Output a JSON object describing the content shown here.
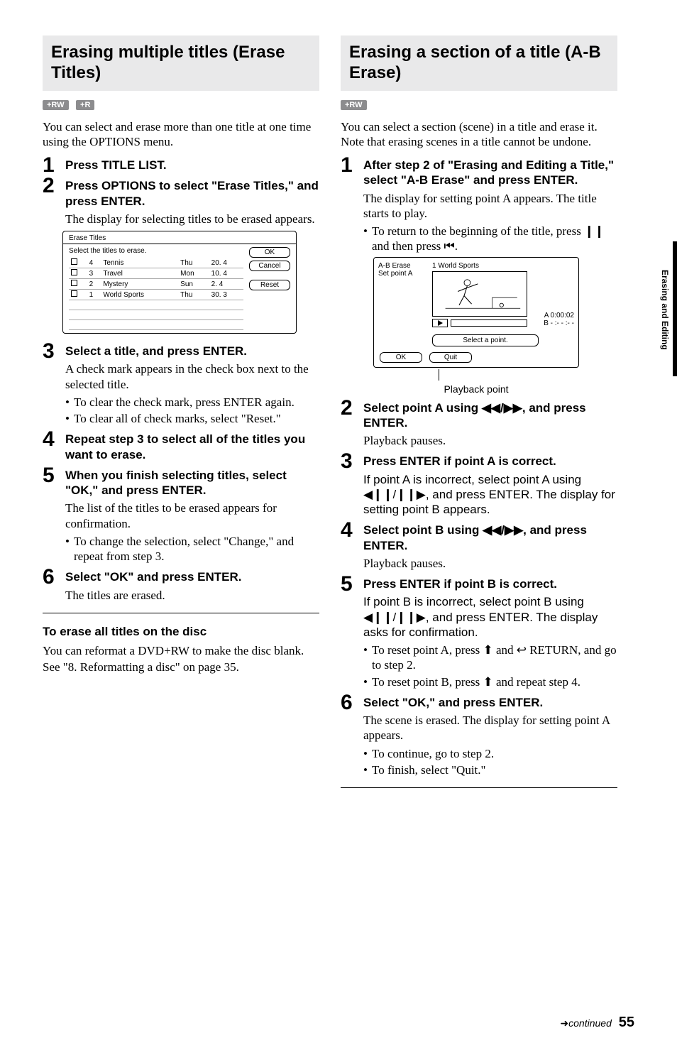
{
  "side_tab": "Erasing and Editing",
  "footer": {
    "continued": "continued",
    "page": "55"
  },
  "left": {
    "title": "Erasing multiple titles (Erase Titles)",
    "badges": [
      "+RW",
      "+R"
    ],
    "intro": "You can select and erase more than one title at one time using the OPTIONS menu.",
    "steps": [
      {
        "title": "Press TITLE LIST."
      },
      {
        "title": "Press OPTIONS to select \"Erase Titles,\" and press ENTER.",
        "body": "The display for selecting titles to be erased appears."
      },
      {
        "title": "Select a title, and press ENTER.",
        "body": "A check mark appears in the check box next to the selected title.",
        "bullets": [
          "To clear the check mark, press ENTER again.",
          "To clear all of check marks, select \"Reset.\""
        ]
      },
      {
        "title": "Repeat step 3 to select all of the titles you want to erase."
      },
      {
        "title": "When you finish selecting titles, select \"OK,\" and press ENTER.",
        "body": "The list of the titles to be erased appears for confirmation.",
        "bullets": [
          "To change the selection, select \"Change,\" and repeat from step 3."
        ]
      },
      {
        "title": "Select \"OK\" and press ENTER.",
        "body": "The titles are erased."
      }
    ],
    "subheading": "To erase all titles on the disc",
    "subbody1": "You can reformat a DVD+RW to make the disc blank.",
    "subbody2": "See \"8. Reformatting a disc\" on page 35.",
    "dialog": {
      "title": "Erase Titles",
      "select_label": "Select the titles to erase.",
      "rows": [
        {
          "n": "4",
          "name": "Tennis",
          "day": "Thu",
          "len": "20. 4"
        },
        {
          "n": "3",
          "name": "Travel",
          "day": "Mon",
          "len": "10. 4"
        },
        {
          "n": "2",
          "name": "Mystery",
          "day": "Sun",
          "len": "2. 4"
        },
        {
          "n": "1",
          "name": "World Sports",
          "day": "Thu",
          "len": "30. 3"
        }
      ],
      "ok": "OK",
      "cancel": "Cancel",
      "reset": "Reset"
    }
  },
  "right": {
    "title": "Erasing a section of a title (A-B Erase)",
    "badges": [
      "+RW"
    ],
    "intro": "You can select a section (scene) in a title and erase it. Note that erasing scenes in a title cannot be undone.",
    "steps": [
      {
        "title": "After step 2 of \"Erasing and Editing a Title,\" select \"A-B Erase\" and press ENTER.",
        "body": "The display for setting point A appears. The title starts to play.",
        "bullets": [
          "To return to the beginning of the title, press ❙❙ and then press ⏮."
        ]
      },
      {
        "title": "Select point A using ◀◀/▶▶, and press ENTER.",
        "body": "Playback pauses."
      },
      {
        "title": "Press ENTER if point A is correct.",
        "body": "If point A is incorrect, select point A using ◀❙❙/❙❙▶, and press ENTER. The display for setting point B appears."
      },
      {
        "title": "Select point B using ◀◀/▶▶, and press ENTER.",
        "body": "Playback pauses."
      },
      {
        "title": "Press ENTER if point B is correct.",
        "body": "If point B is incorrect, select point B using ◀❙❙/❙❙▶, and press ENTER. The display asks for confirmation.",
        "bullets": [
          "To reset point A, press ⬆ and ↩ RETURN, and go to step 2.",
          "To reset point B, press ⬆ and repeat step 4."
        ]
      },
      {
        "title": "Select \"OK,\" and press ENTER.",
        "body": "The scene is erased. The display for setting point A appears.",
        "bullets": [
          "To continue, go to step 2.",
          "To finish, select \"Quit.\""
        ]
      }
    ],
    "caption": "Playback point",
    "dialog": {
      "label1": "A-B Erase",
      "label2": "Set point A",
      "clip": "1 World Sports",
      "timeA": "A 0:00:02",
      "timeB": "B - :- - :- -",
      "select": "Select a point.",
      "ok": "OK",
      "quit": "Quit"
    }
  }
}
